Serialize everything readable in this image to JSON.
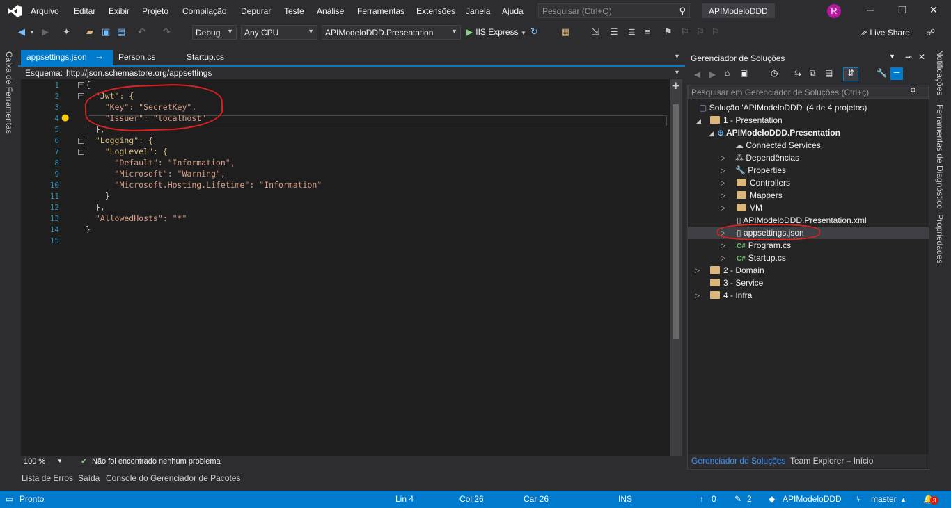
{
  "menu": [
    "Arquivo",
    "Editar",
    "Exibir",
    "Projeto",
    "Compilação",
    "Depurar",
    "Teste",
    "Análise",
    "Ferramentas",
    "Extensões",
    "Janela",
    "Ajuda"
  ],
  "search_placeholder": "Pesquisar (Ctrl+Q)",
  "solution_title": "APIModeloDDD",
  "avatar_letter": "R",
  "toolbar": {
    "config": "Debug",
    "platform": "Any CPU",
    "startup_project": "APIModeloDDD.Presentation",
    "run_label": "IIS Express",
    "live_share": "Live Share"
  },
  "left_strip_label": "Caixa de Ferramentas",
  "tabs": [
    {
      "label": "appsettings.json",
      "pin": "⊸",
      "close": "✕"
    },
    {
      "label": "Person.cs"
    },
    {
      "label": "Startup.cs"
    }
  ],
  "schema": {
    "label": "Esquema:",
    "value": "http://json.schemastore.org/appsettings"
  },
  "editor": {
    "line_numbers": [
      "1",
      "2",
      "3",
      "4",
      "5",
      "6",
      "7",
      "8",
      "9",
      "10",
      "11",
      "12",
      "13",
      "14",
      "15"
    ],
    "lines": [
      "{",
      "  \"Jwt\": {",
      "    \"Key\": \"SecretKey\",",
      "    \"Issuer\": \"localhost\"",
      "  },",
      "  \"Logging\": {",
      "    \"LogLevel\": {",
      "      \"Default\": \"Information\",",
      "      \"Microsoft\": \"Warning\",",
      "      \"Microsoft.Hosting.Lifetime\": \"Information\"",
      "    }",
      "  },",
      "  \"AllowedHosts\": \"*\"",
      "}",
      ""
    ]
  },
  "editor_footer": {
    "zoom": "100 %",
    "issues": "Não foi encontrado nenhum problema"
  },
  "bottom_tabs": [
    "Lista de Erros",
    "Saída",
    "Console do Gerenciador de Pacotes"
  ],
  "solution_explorer": {
    "title": "Gerenciador de Soluções",
    "search_placeholder": "Pesquisar em Gerenciador de Soluções (Ctrl+ç)",
    "solution": "Solução 'APIModeloDDD' (4 de 4 projetos)",
    "presentation_folder": "1 - Presentation",
    "project": "APIModeloDDD.Presentation",
    "items": [
      "Connected Services",
      "Dependências",
      "Properties",
      "Controllers",
      "Mappers",
      "VM",
      "APIModeloDDD.Presentation.xml",
      "appsettings.json",
      "Program.cs",
      "Startup.cs"
    ],
    "other_folders": [
      "2 - Domain",
      "3 - Service",
      "4 - Infra"
    ],
    "tabs": [
      "Gerenciador de Soluções",
      "Team Explorer – Início"
    ]
  },
  "right_strip": [
    "Notificações",
    "Ferramentas de Diagnóstico",
    "Propriedades"
  ],
  "status": {
    "ready": "Pronto",
    "line": "Lin 4",
    "col": "Col 26",
    "car": "Car 26",
    "mode": "INS",
    "up": "0",
    "pencil": "2",
    "repo": "APIModeloDDD",
    "branch": "master",
    "notifications": "3"
  },
  "colors": {
    "accent": "#007acc",
    "annotation": "#e02020"
  }
}
